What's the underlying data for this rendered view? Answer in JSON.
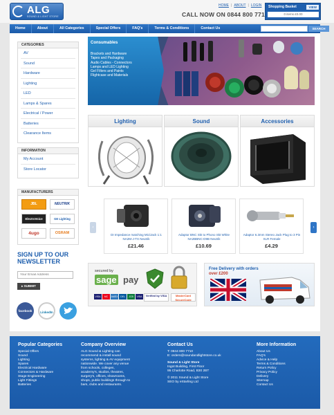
{
  "brand": {
    "name": "ALG",
    "tagline": "SOUND & LIGHT STORE"
  },
  "header": {
    "top_links": [
      "HOME",
      "ABOUT",
      "LOGIN"
    ],
    "call_now": "CALL NOW ON 0844 800 7710",
    "basket": {
      "title": "Shopping Basket",
      "view_label": "VIEW",
      "summary": "0 items £0.00"
    }
  },
  "nav": {
    "items": [
      "Home",
      "About",
      "All Categories",
      "Special Offers",
      "FAQ's",
      "Terms & Conditions",
      "Contact Us"
    ],
    "search_label": "SEARCH"
  },
  "sidebar": {
    "categories_title": "CATEGORIES",
    "categories": [
      "AV",
      "Sound",
      "Hardware",
      "Lighting",
      "LED",
      "Lamps & Spares",
      "Electrical / Power",
      "Batteries",
      "Clearance Items"
    ],
    "information_title": "INFORMATION",
    "information": [
      "My Account",
      "Store Locator"
    ],
    "manufacturers_title": "MANUFACTURERS",
    "manufacturers": [
      "JBL",
      "NEUTRIK",
      "ElectroVoice",
      "GE Lighting",
      "4ugo",
      "OSRAM"
    ]
  },
  "signup": {
    "title_line1": "SIGN UP TO OUR",
    "title_line2": "NEWSLETTER",
    "email_placeholder": "Your Email Address",
    "submit_label": "SUBMIT"
  },
  "social": [
    "facebook",
    "LinkedIn",
    "twitter"
  ],
  "hero": {
    "heading": "Consumables",
    "items": [
      "Brackets and Hardware",
      "Tapes and Packaging",
      "Audio Cables - Connectors",
      "Lamps and LED Lighting",
      "Gel Filters and Paints",
      "Flightcase and Materials"
    ]
  },
  "category_boxes": [
    {
      "title": "Lighting",
      "icon": "par-can-light-icon"
    },
    {
      "title": "Sound",
      "icon": "speaker-cone-icon"
    },
    {
      "title": "Accessories",
      "icon": "rack-case-icon"
    }
  ],
  "products": [
    {
      "desc": "DI Impedance matching Mic/Jack 1:1 NA2M-J-TX Neutrik",
      "price": "£21.46"
    },
    {
      "desc": "Adaptor BNC Skt to Phono Skt White NA2BBNC-D9B Neutrik",
      "price": "£10.69"
    },
    {
      "desc": "Adaptor 6.3mm Stereo Jack Plug to 3 Pin XLR Female",
      "price": "£4.29"
    }
  ],
  "sage_banner": {
    "secured_by": "secured by",
    "brand_a": "sage",
    "brand_b": "pay",
    "cards": [
      "VISA",
      "MC",
      "AMEX",
      "DEL",
      "JCB",
      "VISA"
    ],
    "verified": "Verified by VISA",
    "securecode": "MasterCard SecureCode"
  },
  "delivery_banner": {
    "line1": "Free Delivery with orders",
    "line2": "over £200"
  },
  "footer": {
    "popular_title": "Popular Categories",
    "popular": [
      "Special Offers",
      "Sound",
      "Lighting",
      "Spares",
      "Electrical Hardware",
      "Connectors & Hardware",
      "Stage Engineering",
      "Light Fittings",
      "Batteries"
    ],
    "overview_title": "Company Overview",
    "overview_lines": [
      "ALG Sound & Lighting can",
      "recommend & install sound",
      "systems, lighting & AV equipment",
      "nationwide. We cover any venue",
      "from schools, colleges,",
      "academy's, studios, theatres,",
      "surgery's, offices, showrooms,",
      "shops, public buildings through to",
      "bars, clubs and restaurants."
    ],
    "contact_title": "Contact Us",
    "contact_phone": "T: 0844 800 7710",
    "contact_email": "E: orders@soundandlightstore.co.uk",
    "store_name": "Sound & Light Store",
    "address_lines": [
      "Ingot Building, First Floor",
      "95 Charlotte Road, B30 2BT"
    ],
    "copyright_lines": [
      "© 2011 Sound & Light Store",
      "SEO by eStarling Ltd"
    ],
    "more_title": "More Information",
    "more": [
      "About Us",
      "FAQ's",
      "Advice & Help",
      "Terms & Conditions",
      "Return Policy",
      "Privacy Policy",
      "Delivery",
      "Sitemap",
      "Contact Us"
    ]
  }
}
